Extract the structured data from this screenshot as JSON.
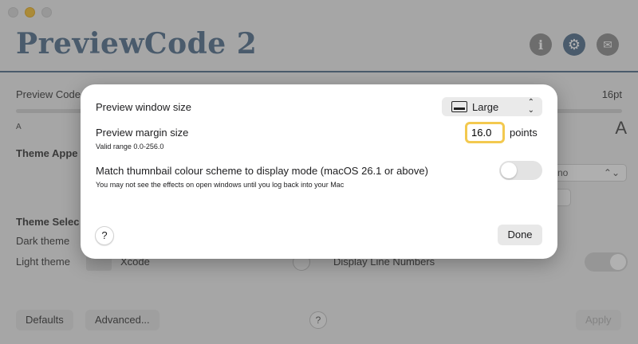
{
  "app": {
    "title": "PreviewCode 2",
    "header_icons": [
      "info-icon",
      "gear-icon",
      "mail-icon"
    ],
    "accent_color": "#4f6c88"
  },
  "background": {
    "preview_code_label": "Preview Code",
    "font_size_value": "16pt",
    "slider_min_label": "A",
    "slider_max_label": "A",
    "theme_appearance_label": "Theme Appe",
    "appearance_select_fragment": "no",
    "theme_selection_label": "Theme Selec",
    "dark_theme_label": "Dark theme",
    "light_theme_label": "Light theme",
    "light_theme_value": "Xcode",
    "display_line_numbers_label": "Display Line Numbers",
    "defaults_button": "Defaults",
    "advanced_button": "Advanced...",
    "help_label": "?",
    "apply_button": "Apply"
  },
  "dialog": {
    "window_size_label": "Preview window size",
    "window_size_value": "Large",
    "margin_label": "Preview margin size",
    "margin_hint": "Valid range 0.0-256.0",
    "margin_value": "16.0",
    "margin_unit": "points",
    "match_label": "Match thumnbail colour scheme to display mode (macOS 26.1 or above)",
    "match_hint": "You may not see the effects on open windows until you log back into your Mac",
    "match_enabled": false,
    "help_label": "?",
    "done_button": "Done"
  }
}
